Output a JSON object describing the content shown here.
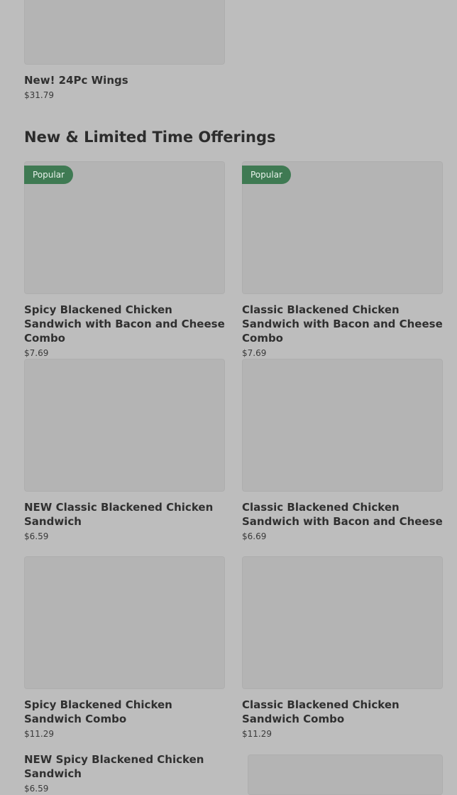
{
  "top_card": {
    "name": "New! 24Pc Wings",
    "price": "$31.79"
  },
  "section": {
    "title": "New & Limited Time Offerings"
  },
  "items": [
    {
      "name": "Spicy Blackened Chicken Sandwich with Bacon and Cheese Combo",
      "price": "$7.69",
      "badge": "Popular"
    },
    {
      "name": "Classic Blackened Chicken Sandwich with Bacon and Cheese Combo",
      "price": "$7.69",
      "badge": "Popular"
    },
    {
      "name": "NEW Classic Blackened Chicken Sandwich",
      "price": "$6.59"
    },
    {
      "name": "Classic Blackened Chicken Sandwich with Bacon and Cheese",
      "price": "$6.69"
    },
    {
      "name": "Spicy Blackened Chicken Sandwich Combo",
      "price": "$11.29"
    },
    {
      "name": "Classic Blackened Chicken Sandwich Combo",
      "price": "$11.29"
    },
    {
      "name": "NEW Spicy Blackened Chicken Sandwich",
      "price": "$6.59"
    }
  ],
  "colors": {
    "background": "#bdbdbd",
    "badge_bg": "#3f7a53"
  }
}
